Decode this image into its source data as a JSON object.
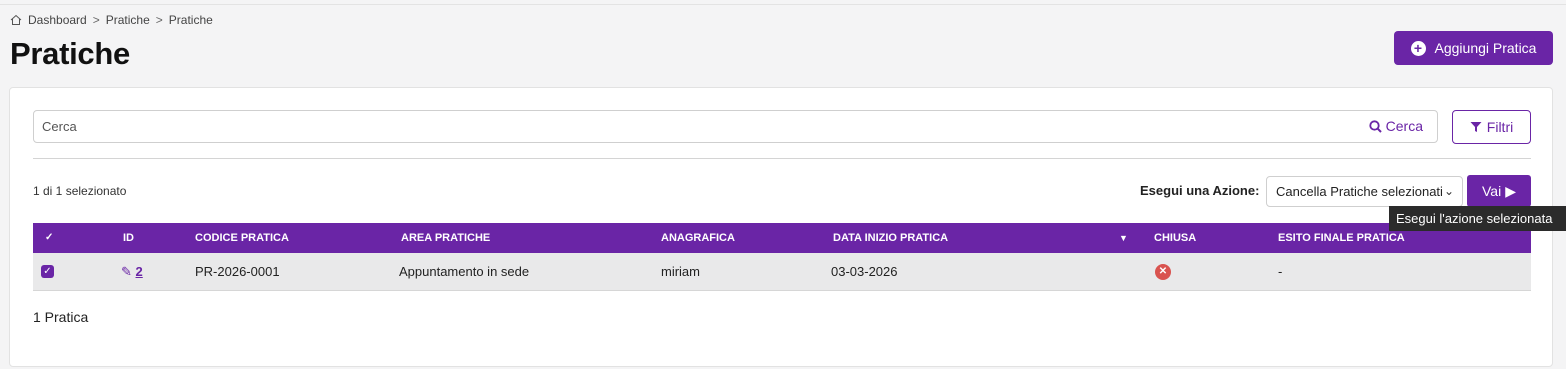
{
  "breadcrumb": [
    "Dashboard",
    "Pratiche",
    "Pratiche"
  ],
  "page_title": "Pratiche",
  "add_button_label": "Aggiungi Pratica",
  "search": {
    "placeholder": "Cerca",
    "button_label": "Cerca"
  },
  "filter_button_label": "Filtri",
  "selection_count": "1 di 1 selezionato",
  "action": {
    "label": "Esegui una Azione:",
    "selected": "Cancella Pratiche selezionati",
    "go_label": "Vai"
  },
  "table": {
    "headers": [
      "ID",
      "CODICE PRATICA",
      "AREA PRATICHE",
      "ANAGRAFICA",
      "DATA INIZIO PRATICA",
      "CHIUSA",
      "ESITO FINALE PRATICA"
    ],
    "rows": [
      {
        "id": "2",
        "codice": "PR-2026-0001",
        "area": "Appuntamento in sede",
        "anagrafica": "miriam",
        "data_inizio": "03-03-2026",
        "chiusa": false,
        "esito": "-"
      }
    ]
  },
  "footer_count": "1 Pratica",
  "tooltip": "Esegui l'azione selezionata",
  "colors": {
    "accent": "#6a25a6",
    "danger": "#d9534f"
  }
}
